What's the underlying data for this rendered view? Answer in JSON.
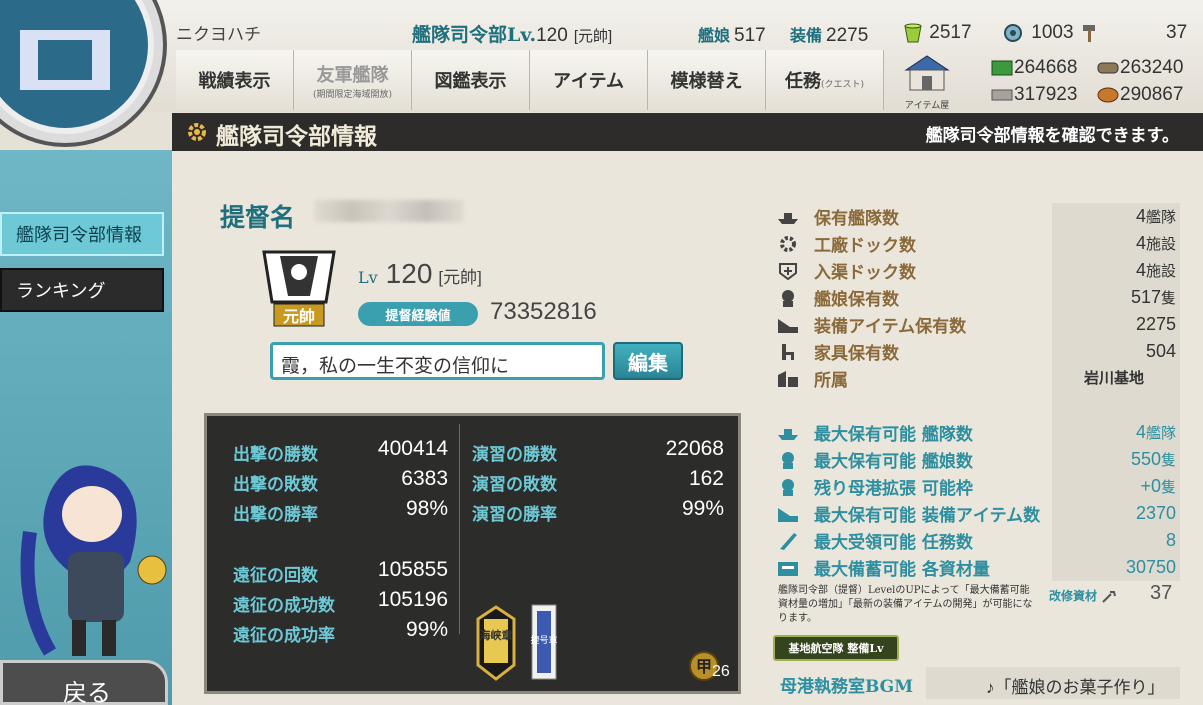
{
  "topbar": {
    "user_name": "ニクヨハチ",
    "hq_level_label": "艦隊司令部Lv.",
    "hq_level": "120",
    "hq_rank": "[元帥]",
    "ships_label": "艦娘",
    "ships": "517",
    "equip_label": "装備",
    "equip": "2275",
    "buckets": "2517",
    "dev_materials": "1003",
    "improve_materials": "37"
  },
  "nav": {
    "record": "戦績表示",
    "friend_fleet": "友軍艦隊",
    "friend_fleet_sub": "(期間限定海域開放)",
    "library": "図鑑表示",
    "items": "アイテム",
    "furniture": "模様替え",
    "quests": "任務",
    "quests_sub": "(クエスト)",
    "shop_label": "アイテム屋"
  },
  "resources": {
    "fuel": "264668",
    "ammo": "263240",
    "steel": "317923",
    "bauxite": "290867"
  },
  "header": {
    "title": "艦隊司令部情報",
    "description": "艦隊司令部情報を確認できます。"
  },
  "sidebar": {
    "hq_info": "艦隊司令部情報",
    "ranking": "ランキング",
    "back": "戻る"
  },
  "profile": {
    "admiral_label": "提督名",
    "rank_badge": "元帥",
    "lv_label": "Lv",
    "level": "120",
    "rank": "[元帥]",
    "exp_label": "提督経験値",
    "exp": "73352816",
    "comment": "霞，私の一生不変の信仰に",
    "edit": "編集"
  },
  "stats": {
    "sortie_wins_label": "出撃の勝数",
    "sortie_wins": "400414",
    "sortie_losses_label": "出撃の敗数",
    "sortie_losses": "6383",
    "sortie_rate_label": "出撃の勝率",
    "sortie_rate": "98%",
    "exercise_wins_label": "演習の勝数",
    "exercise_wins": "22068",
    "exercise_losses_label": "演習の敗数",
    "exercise_losses": "162",
    "exercise_rate_label": "演習の勝率",
    "exercise_rate": "99%",
    "expedition_count_label": "遠征の回数",
    "expedition_count": "105855",
    "expedition_success_label": "遠征の成功数",
    "expedition_success": "105196",
    "expedition_rate_label": "遠征の成功率",
    "expedition_rate": "99%",
    "medal1": "海峡章",
    "medal2": "捷号章",
    "kou_badge": "甲",
    "kou_count": "26"
  },
  "right": {
    "fleets_label": "保有艦隊数",
    "fleets": "4",
    "fleets_unit": "艦隊",
    "docks_label": "工廠ドック数",
    "docks": "4",
    "docks_unit": "施設",
    "repair_label": "入渠ドック数",
    "repair": "4",
    "repair_unit": "施設",
    "ships_label": "艦娘保有数",
    "ships": "517",
    "ships_unit": "隻",
    "equip_label": "装備アイテム保有数",
    "equip": "2275",
    "furniture_label": "家具保有数",
    "furniture": "504",
    "base_label": "所属",
    "base": "岩川基地",
    "max_fleets_label": "最大保有可能 艦隊数",
    "max_fleets": "4",
    "max_fleets_unit": "艦隊",
    "max_ships_label": "最大保有可能 艦娘数",
    "max_ships": "550",
    "max_ships_unit": "隻",
    "expand_label": "残り母港拡張 可能枠",
    "expand": "+0",
    "expand_unit": "隻",
    "max_equip_label": "最大保有可能 装備アイテム数",
    "max_equip": "2370",
    "max_quests_label": "最大受領可能 任務数",
    "max_quests": "8",
    "max_res_label": "最大備蓄可能 各資材量",
    "max_res": "30750",
    "note": "艦隊司令部（提督）LevelのUPによって「最大備蓄可能資材量の増加」「最新の装備アイテムの開発」が可能になります。",
    "kaishu_label": "改修資材",
    "kaishu": "37",
    "base_air_button": "基地航空隊 整備Lv",
    "bgm_label": "母港執務室BGM",
    "bgm": "♪「艦娘のお菓子作り」"
  },
  "colors": {
    "accent": "#1f6f7d",
    "teal": "#3a9fae",
    "header_bg": "#2e2c2a",
    "stats_bg": "#2c2c2a",
    "label_blue": "#6ec9d6"
  }
}
